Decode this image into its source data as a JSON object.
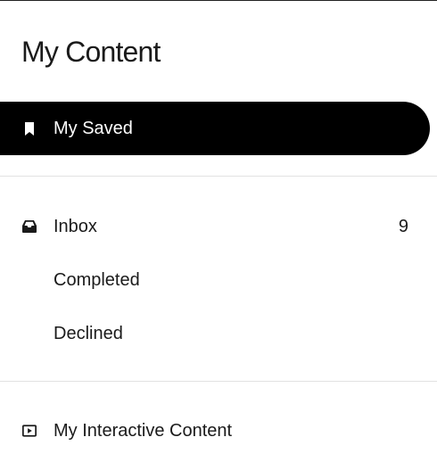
{
  "header": {
    "title": "My Content"
  },
  "nav": {
    "saved": {
      "label": "My Saved",
      "icon": "bookmark-icon"
    },
    "inbox": {
      "label": "Inbox",
      "count": "9",
      "icon": "inbox-icon"
    },
    "completed": {
      "label": "Completed"
    },
    "declined": {
      "label": "Declined"
    },
    "interactive": {
      "label": "My Interactive Content",
      "icon": "play-icon"
    }
  },
  "colors": {
    "active_bg": "#000000",
    "active_text": "#ffffff",
    "divider": "#e2e2e2"
  }
}
